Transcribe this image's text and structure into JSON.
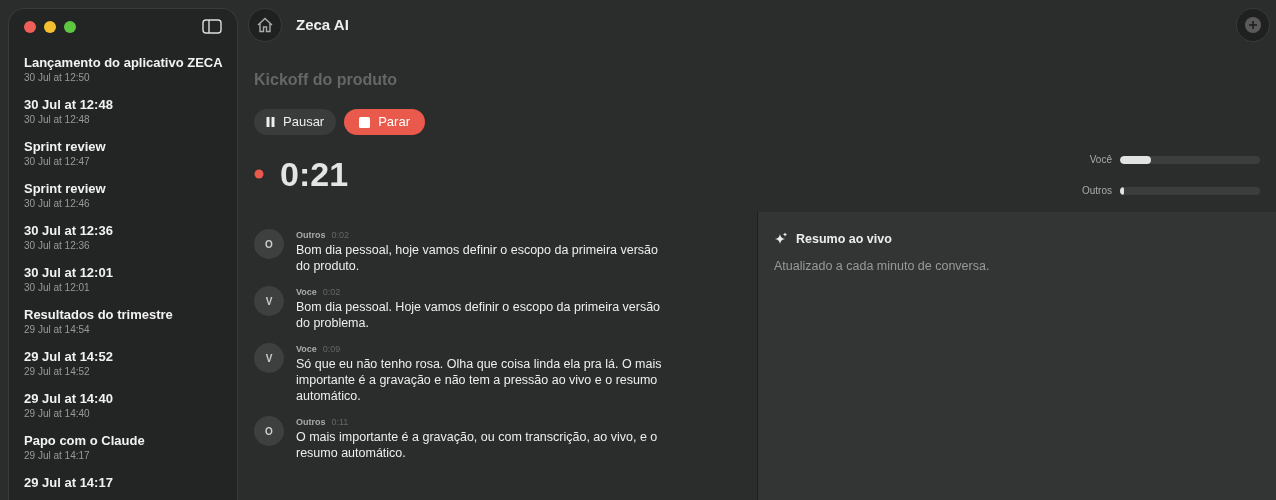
{
  "app": {
    "title": "Zeca AI"
  },
  "sidebar": {
    "items": [
      {
        "title": "Lançamento do aplicativo ZECA",
        "date": "30 Jul at 12:50"
      },
      {
        "title": "30 Jul at 12:48",
        "date": "30 Jul at 12:48"
      },
      {
        "title": "Sprint review",
        "date": "30 Jul at 12:47"
      },
      {
        "title": "Sprint review",
        "date": "30 Jul at 12:46"
      },
      {
        "title": "30 Jul at 12:36",
        "date": "30 Jul at 12:36"
      },
      {
        "title": "30 Jul at 12:01",
        "date": "30 Jul at 12:01"
      },
      {
        "title": "Resultados do trimestre",
        "date": "29 Jul at 14:54"
      },
      {
        "title": "29 Jul at 14:52",
        "date": "29 Jul at 14:52"
      },
      {
        "title": "29 Jul at 14:40",
        "date": "29 Jul at 14:40"
      },
      {
        "title": "Papo com o Claude",
        "date": "29 Jul at 14:17"
      },
      {
        "title": "29 Jul at 14:17"
      }
    ]
  },
  "meeting": {
    "title": "Kickoff do produto",
    "buttons": [
      {
        "kind": "pause",
        "label": "Pausar"
      },
      {
        "kind": "stop",
        "label": "Parar"
      }
    ],
    "timer": "0:21",
    "meters": [
      {
        "label": "Você",
        "level": 0.22
      },
      {
        "label": "Outros",
        "level": 0.03
      }
    ]
  },
  "transcript": [
    {
      "avatar": "O",
      "speaker": "Outros",
      "time": "0:02",
      "text": "Bom dia pessoal, hoje vamos definir o escopo da primeira versão do produto."
    },
    {
      "avatar": "V",
      "speaker": "Voce",
      "time": "0:02",
      "text": "Bom dia pessoal. Hoje vamos definir o escopo da primeira versão do problema."
    },
    {
      "avatar": "V",
      "speaker": "Voce",
      "time": "0:09",
      "text": "Só que eu não tenho rosa. Olha que coisa linda ela pra lá. O mais importante é a gravação e não tem a pressão ao vivo e o resumo automático."
    },
    {
      "avatar": "O",
      "speaker": "Outros",
      "time": "0:11",
      "text": "O mais importante é a gravação, ou com transcrição, ao vivo, e o resumo automático."
    }
  ],
  "summary": {
    "title": "Resumo ao vivo",
    "subtitle": "Atualizado a cada minuto de conversa."
  }
}
